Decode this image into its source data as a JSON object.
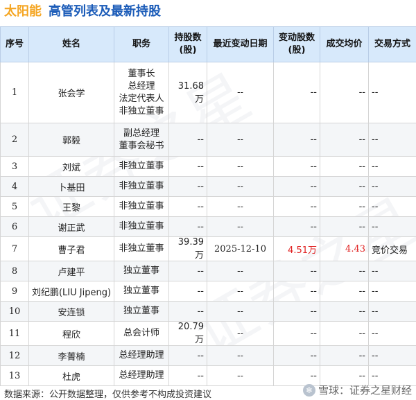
{
  "header": {
    "company": "太阳能",
    "title": "高管列表及最新持股"
  },
  "table": {
    "columns": [
      "序号",
      "姓名",
      "职务",
      "持股数\n(股)",
      "最近变动日期",
      "变动股数\n(股)",
      "成交均价",
      "交易方式"
    ],
    "rows": [
      {
        "idx": "1",
        "name": "张会学",
        "roles": [
          "董事长",
          "总经理",
          "法定代表人",
          "非独立董事"
        ],
        "shares": "31.68万",
        "date": "--",
        "change": "--",
        "price": "--",
        "method": "--"
      },
      {
        "idx": "2",
        "name": "郭毅",
        "roles": [
          "副总经理",
          "董事会秘书"
        ],
        "shares": "--",
        "date": "--",
        "change": "--",
        "price": "--",
        "method": "--"
      },
      {
        "idx": "3",
        "name": "刘斌",
        "roles": [
          "非独立董事"
        ],
        "shares": "--",
        "date": "--",
        "change": "--",
        "price": "--",
        "method": "--"
      },
      {
        "idx": "4",
        "name": "卜基田",
        "roles": [
          "非独立董事"
        ],
        "shares": "--",
        "date": "--",
        "change": "--",
        "price": "--",
        "method": "--"
      },
      {
        "idx": "5",
        "name": "王黎",
        "roles": [
          "非独立董事"
        ],
        "shares": "--",
        "date": "--",
        "change": "--",
        "price": "--",
        "method": "--"
      },
      {
        "idx": "6",
        "name": "谢正武",
        "roles": [
          "非独立董事"
        ],
        "shares": "--",
        "date": "--",
        "change": "--",
        "price": "--",
        "method": "--"
      },
      {
        "idx": "7",
        "name": "曹子君",
        "roles": [
          "非独立董事"
        ],
        "shares": "39.39万",
        "date": "2025-12-10",
        "change": "4.51万",
        "price": "4.43",
        "method": "竞价交易"
      },
      {
        "idx": "8",
        "name": "卢建平",
        "roles": [
          "独立董事"
        ],
        "shares": "--",
        "date": "--",
        "change": "--",
        "price": "--",
        "method": "--"
      },
      {
        "idx": "9",
        "name": "刘纪鹏(LIU Jipeng)",
        "roles": [
          "独立董事"
        ],
        "shares": "--",
        "date": "--",
        "change": "--",
        "price": "--",
        "method": "--"
      },
      {
        "idx": "10",
        "name": "安连锁",
        "roles": [
          "独立董事"
        ],
        "shares": "--",
        "date": "--",
        "change": "--",
        "price": "--",
        "method": "--"
      },
      {
        "idx": "11",
        "name": "程欣",
        "roles": [
          "总会计师"
        ],
        "shares": "20.79万",
        "date": "--",
        "change": "--",
        "price": "--",
        "method": "--"
      },
      {
        "idx": "12",
        "name": "李菁楠",
        "roles": [
          "总经理助理"
        ],
        "shares": "--",
        "date": "--",
        "change": "--",
        "price": "--",
        "method": "--"
      },
      {
        "idx": "13",
        "name": "杜虎",
        "roles": [
          "总经理助理"
        ],
        "shares": "--",
        "date": "--",
        "change": "--",
        "price": "--",
        "method": "--"
      }
    ]
  },
  "watermark": "证券之星",
  "footer": {
    "source": "数据来源：公开数据整理，仅供参考不构成投资建议",
    "brand": "雪球：证券之星财经"
  },
  "colors": {
    "company": "#f5a623",
    "title": "#1a5bb8",
    "header_bg": "#d7e9fb",
    "highlight": "#e02020"
  }
}
